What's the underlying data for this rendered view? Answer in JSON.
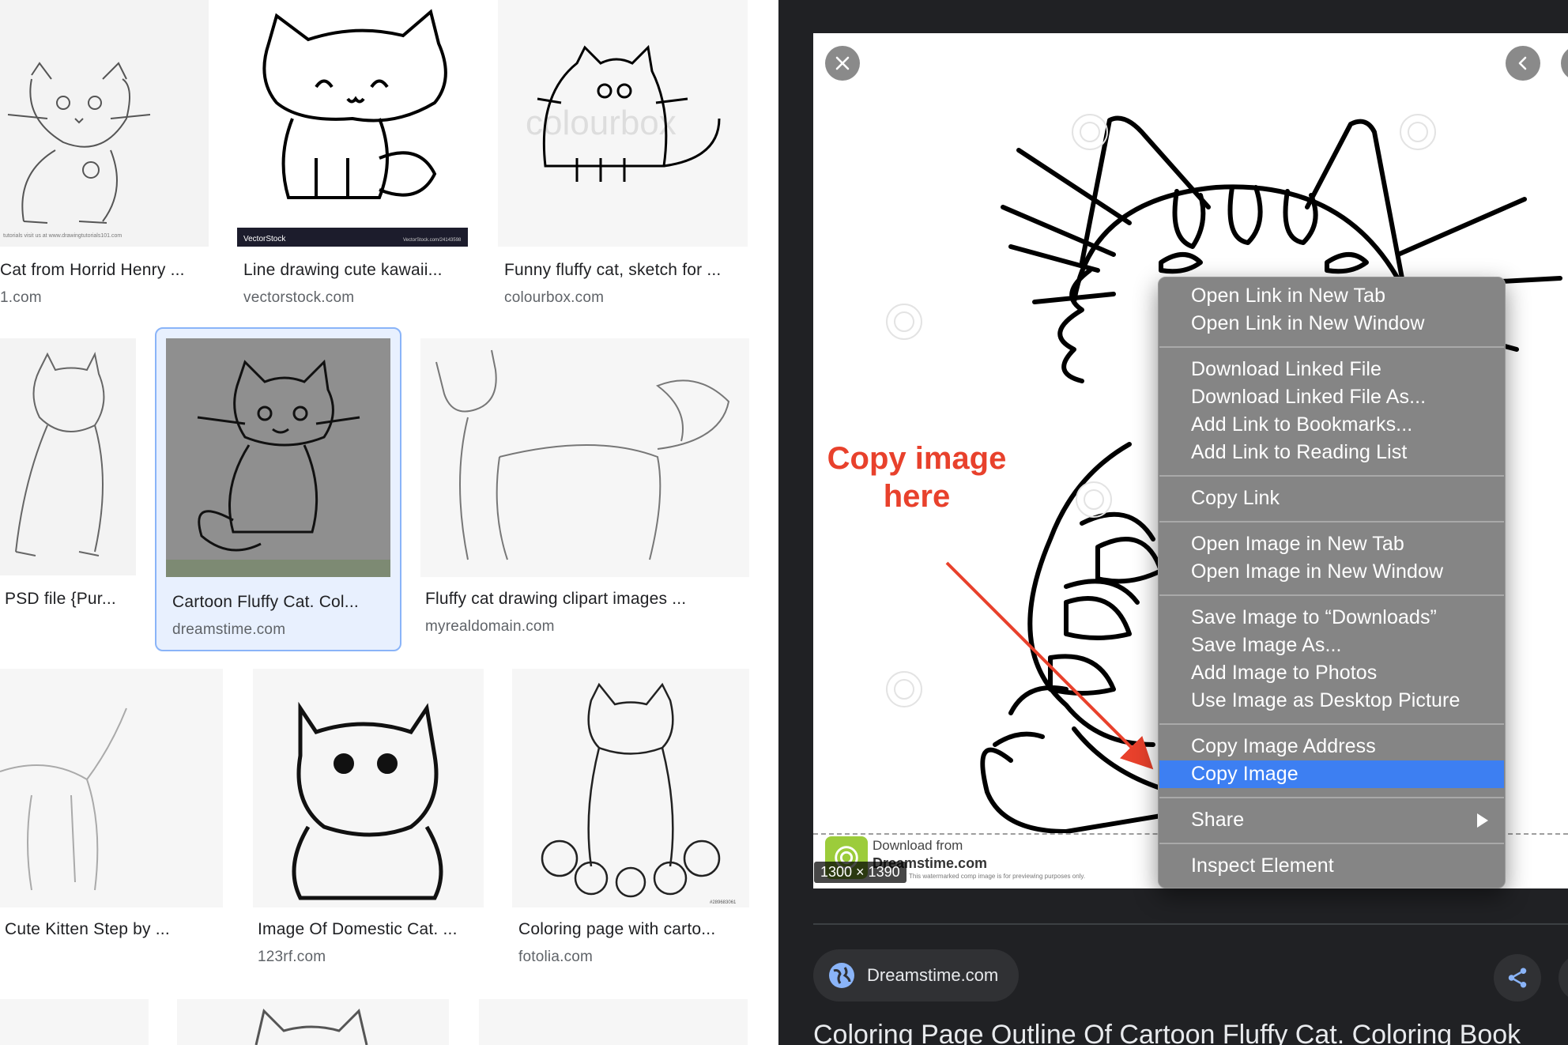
{
  "results": [
    {
      "title": "Cat from Horrid Henry ...",
      "source": "1.com"
    },
    {
      "title": "Line drawing cute kawaii...",
      "source": "vectorstock.com"
    },
    {
      "title": "Funny fluffy cat, sketch for ...",
      "source": "colourbox.com"
    },
    {
      "title": "PSD file {Pur...",
      "source": ""
    },
    {
      "title": "Cartoon Fluffy Cat. Col...",
      "source": "dreamstime.com"
    },
    {
      "title": "Fluffy cat drawing clipart images ...",
      "source": "myrealdomain.com"
    },
    {
      "title": "Cute Kitten Step by ...",
      "source": ""
    },
    {
      "title": "Image Of Domestic Cat. ...",
      "source": "123rf.com"
    },
    {
      "title": "Coloring page with carto...",
      "source": "fotolia.com"
    }
  ],
  "thumb_text": {
    "vectorstock_left": "VectorStock",
    "vectorstock_right": "VectorStock.com/24143598",
    "colourbox_watermark": "colourbox",
    "horrid_caption": "tutorials visit us at www.drawingtutorials101.com",
    "fotolia_id": "#289683061"
  },
  "preview": {
    "annotation_line1": "Copy image",
    "annotation_line2": "here",
    "download_line1": "Download from",
    "download_line2": "Dreamstime.com",
    "download_line3": "This watermarked comp image is for previewing purposes only.",
    "dimensions": "1300 × 1390",
    "source_name": "Dreamstime.com",
    "title": "Coloring Page Outline Of Cartoon Fluffy Cat. Coloring Book"
  },
  "context_menu": {
    "groups": [
      [
        "Open Link in New Tab",
        "Open Link in New Window"
      ],
      [
        "Download Linked File",
        "Download Linked File As...",
        "Add Link to Bookmarks...",
        "Add Link to Reading List"
      ],
      [
        "Copy Link"
      ],
      [
        "Open Image in New Tab",
        "Open Image in New Window"
      ],
      [
        "Save Image to “Downloads”",
        "Save Image As...",
        "Add Image to Photos",
        "Use Image as Desktop Picture"
      ],
      [
        "Copy Image Address",
        "Copy Image"
      ],
      [
        "Share"
      ],
      [
        "Inspect Element"
      ]
    ],
    "highlighted": "Copy Image",
    "submenu": "Share"
  },
  "icons": {
    "close": "close-icon",
    "prev": "chevron-left-icon",
    "globe": "globe-icon",
    "share": "share-icon",
    "submenu": "submenu-arrow-icon"
  },
  "colors": {
    "panel_bg": "#202124",
    "menu_bg": "#858585",
    "menu_highlight": "#3d7ff2",
    "annotation": "#e8412c",
    "selected_border": "#8ab4f8"
  }
}
